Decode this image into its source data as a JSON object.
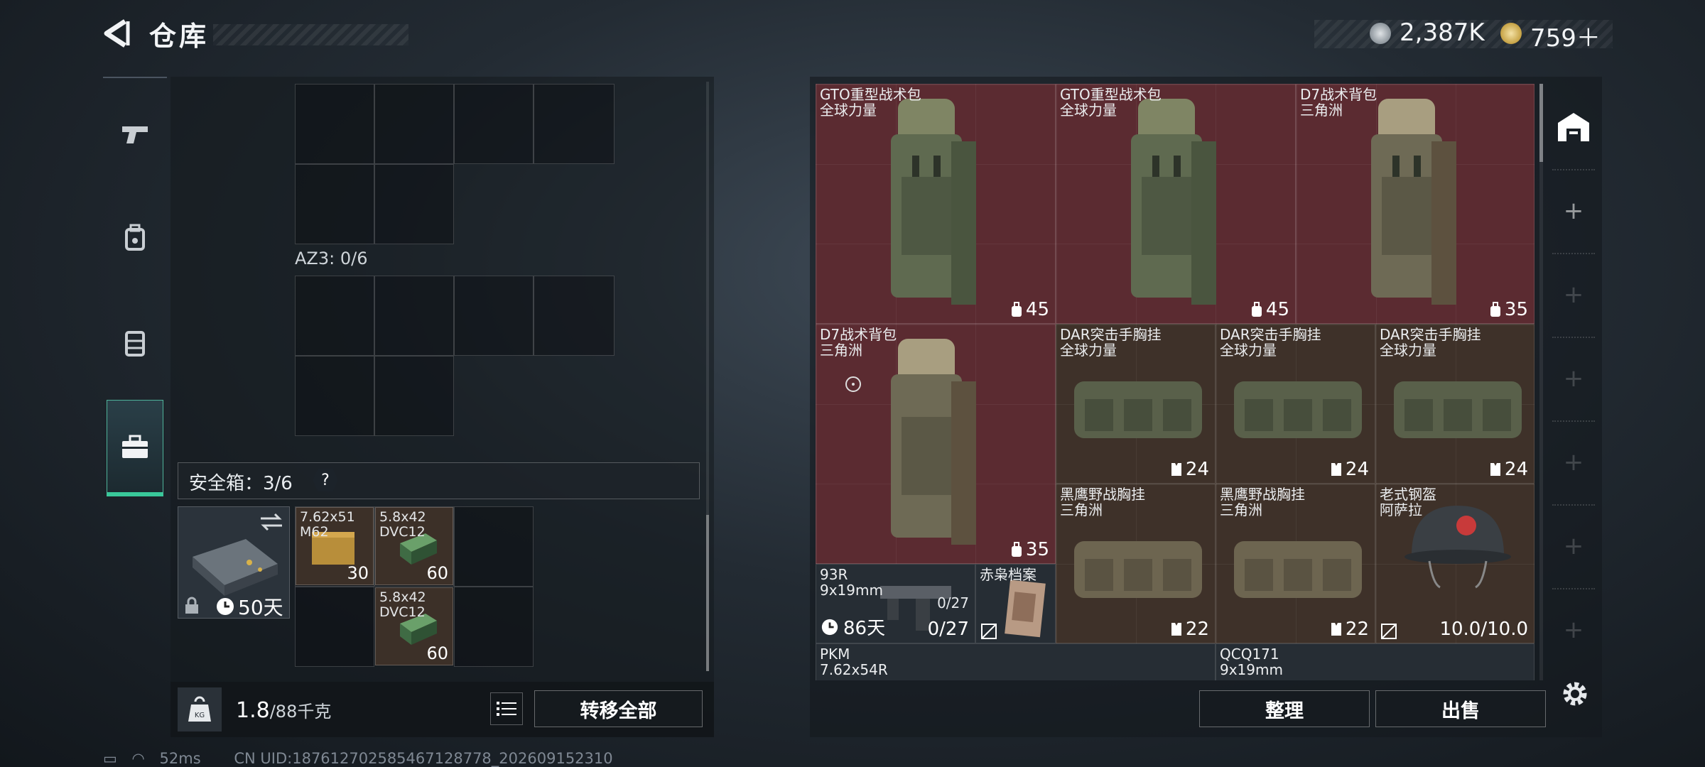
{
  "header": {
    "title": "仓库"
  },
  "currency": {
    "silver": "2,387K",
    "gold": "759＋"
  },
  "sidebar": {
    "tabs": [
      {
        "name": "weapons"
      },
      {
        "name": "gear"
      },
      {
        "name": "vest"
      },
      {
        "name": "container"
      }
    ]
  },
  "containers": [
    {
      "label": "AZ3: 0/6"
    }
  ],
  "safebox": {
    "label": "安全箱：3/6",
    "help": "?",
    "time": "50天",
    "items": [
      {
        "name": "7.62x51\nM62",
        "qty": "30"
      },
      {
        "name": "5.8x42\nDVC12",
        "qty": "60"
      },
      {
        "name": "5.8x42\nDVC12",
        "qty": "60"
      }
    ]
  },
  "weight": {
    "current": "1.8",
    "max": "/88千克"
  },
  "buttons": {
    "transfer_all": "转移全部",
    "sort": "整理",
    "sell": "出售"
  },
  "stash": {
    "items": [
      {
        "name": "GTO重型战术包",
        "sub": "全球力量",
        "cap": "45"
      },
      {
        "name": "GTO重型战术包",
        "sub": "全球力量",
        "cap": "45"
      },
      {
        "name": "D7战术背包",
        "sub": "三角洲",
        "cap": "35"
      },
      {
        "name": "D7战术背包",
        "sub": "三角洲",
        "cap": "35"
      },
      {
        "name": "DAR突击手胸挂",
        "sub": "全球力量",
        "cap": "24"
      },
      {
        "name": "DAR突击手胸挂",
        "sub": "全球力量",
        "cap": "24"
      },
      {
        "name": "DAR突击手胸挂",
        "sub": "全球力量",
        "cap": "24"
      },
      {
        "name": "黑鹰野战胸挂",
        "sub": "三角洲",
        "cap": "22"
      },
      {
        "name": "黑鹰野战胸挂",
        "sub": "三角洲",
        "cap": "22"
      },
      {
        "name": "老式钢盔",
        "sub": "阿萨拉",
        "cap": "10.0/10.0"
      },
      {
        "name": "93R",
        "sub": "9x19mm",
        "mag": "0/27",
        "mag2": "0/27",
        "time": "86天"
      },
      {
        "name": "赤枭档案"
      },
      {
        "name": "PKM",
        "sub": "7.62x54R"
      },
      {
        "name": "QCQ171",
        "sub": "9x19mm"
      }
    ]
  },
  "status": {
    "ping": "52ms",
    "uid": "CN UID:1876127025854671287­78_202609152310"
  },
  "colors": {
    "accent": "#39c89a",
    "rare_red": "#5b2b31",
    "uncommon_brown": "#3e3129"
  }
}
